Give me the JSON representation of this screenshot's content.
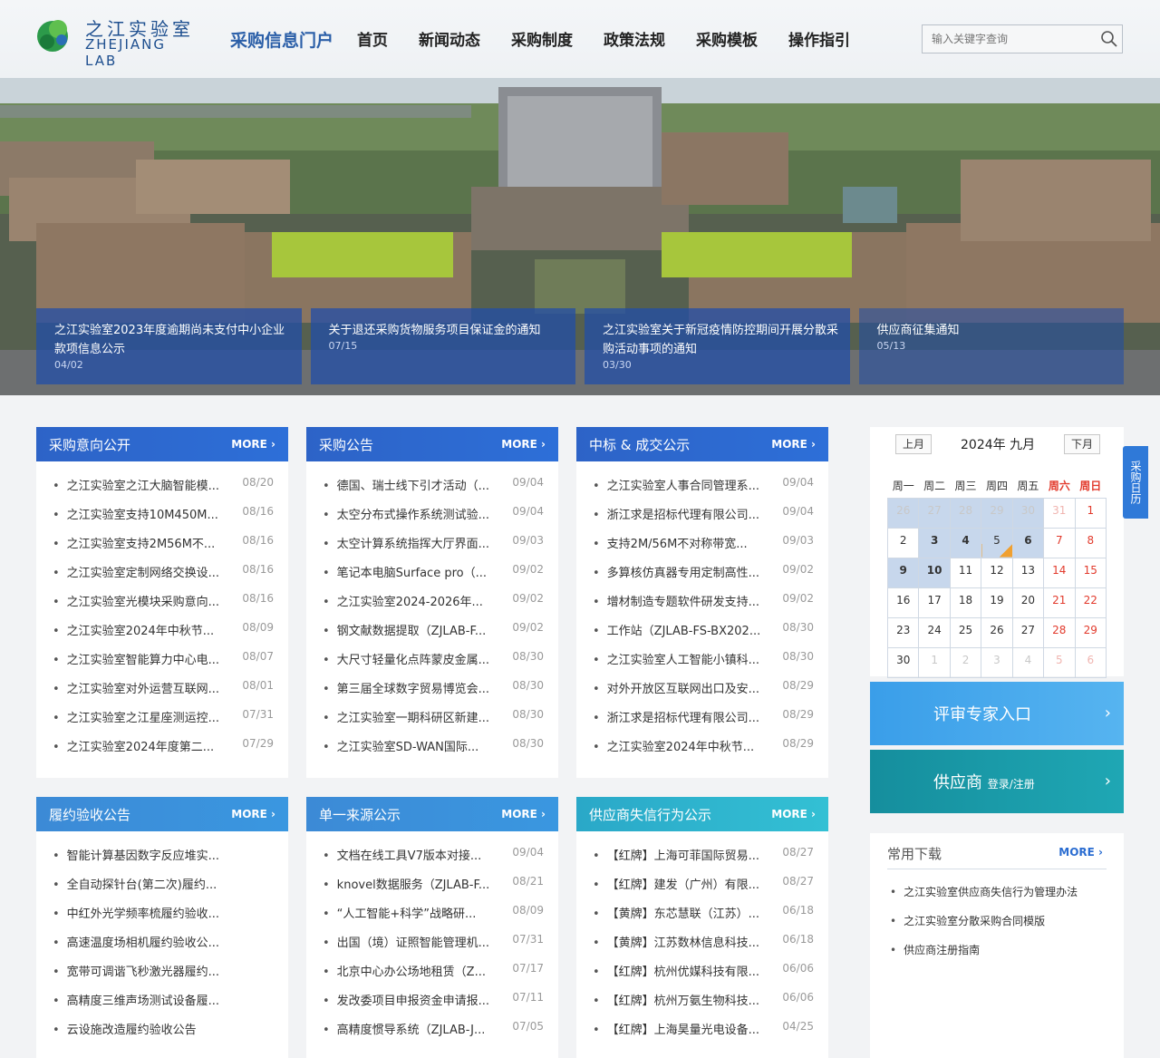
{
  "header": {
    "logo_cn": "之江实验室",
    "logo_en": "ZHEJIANG LAB",
    "portal_title": "采购信息门户",
    "nav": [
      "首页",
      "新闻动态",
      "采购制度",
      "政策法规",
      "采购模板",
      "操作指引"
    ],
    "search_placeholder": "输入关键字查询"
  },
  "banner_news": [
    {
      "title": "之江实验室2023年度逾期尚未支付中小企业款项信息公示",
      "date": "04/02"
    },
    {
      "title": "关于退还采购货物服务项目保证金的通知",
      "date": "07/15"
    },
    {
      "title": "之江实验室关于新冠疫情防控期间开展分散采购活动事项的通知",
      "date": "03/30"
    },
    {
      "title": "供应商征集通知",
      "date": "05/13"
    }
  ],
  "more_label": "MORE",
  "panels": [
    {
      "title": "采购意向公开",
      "items": [
        {
          "t": "之江实验室之江大脑智能模...",
          "d": "08/20"
        },
        {
          "t": "之江实验室支持10M450M...",
          "d": "08/16"
        },
        {
          "t": "之江实验室支持2M56M不...",
          "d": "08/16"
        },
        {
          "t": "之江实验室定制网络交换设...",
          "d": "08/16"
        },
        {
          "t": "之江实验室光模块采购意向...",
          "d": "08/16"
        },
        {
          "t": "之江实验室2024年中秋节...",
          "d": "08/09"
        },
        {
          "t": "之江实验室智能算力中心电...",
          "d": "08/07"
        },
        {
          "t": "之江实验室对外运营互联网...",
          "d": "08/01"
        },
        {
          "t": "之江实验室之江星座测运控...",
          "d": "07/31"
        },
        {
          "t": "之江实验室2024年度第二...",
          "d": "07/29"
        }
      ]
    },
    {
      "title": "采购公告",
      "items": [
        {
          "t": "德国、瑞士线下引才活动（...",
          "d": "09/04"
        },
        {
          "t": "太空分布式操作系统测试验...",
          "d": "09/04"
        },
        {
          "t": "太空计算系统指挥大厅界面...",
          "d": "09/03"
        },
        {
          "t": "笔记本电脑Surface pro（...",
          "d": "09/02"
        },
        {
          "t": "之江实验室2024-2026年...",
          "d": "09/02"
        },
        {
          "t": "钢文献数据提取（ZJLAB-F...",
          "d": "09/02"
        },
        {
          "t": "大尺寸轻量化点阵蒙皮金属...",
          "d": "08/30"
        },
        {
          "t": "第三届全球数字贸易博览会...",
          "d": "08/30"
        },
        {
          "t": "之江实验室一期科研区新建...",
          "d": "08/30"
        },
        {
          "t": "之江实验室SD-WAN国际...",
          "d": "08/30"
        }
      ]
    },
    {
      "title": "中标 & 成交公示",
      "items": [
        {
          "t": "之江实验室人事合同管理系...",
          "d": "09/04"
        },
        {
          "t": "浙江求是招标代理有限公司...",
          "d": "09/04"
        },
        {
          "t": "支持2M/56M不对称带宽...",
          "d": "09/03"
        },
        {
          "t": "多算核仿真器专用定制高性...",
          "d": "09/02"
        },
        {
          "t": "增材制造专题软件研发支持...",
          "d": "09/02"
        },
        {
          "t": "工作站（ZJLAB-FS-BX202...",
          "d": "08/30"
        },
        {
          "t": "之江实验室人工智能小镇科...",
          "d": "08/30"
        },
        {
          "t": "对外开放区互联网出口及安...",
          "d": "08/29"
        },
        {
          "t": "浙江求是招标代理有限公司...",
          "d": "08/29"
        },
        {
          "t": "之江实验室2024年中秋节...",
          "d": "08/29"
        }
      ]
    },
    {
      "title": "履约验收公告",
      "items": [
        {
          "t": "智能计算基因数字反应堆实...",
          "d": ""
        },
        {
          "t": "全自动探针台(第二次)履约...",
          "d": ""
        },
        {
          "t": "中红外光学频率梳履约验收...",
          "d": ""
        },
        {
          "t": "高速温度场相机履约验收公...",
          "d": ""
        },
        {
          "t": "宽带可调谐飞秒激光器履约...",
          "d": ""
        },
        {
          "t": "高精度三维声场测试设备履...",
          "d": ""
        },
        {
          "t": "云设施改造履约验收公告",
          "d": ""
        }
      ]
    },
    {
      "title": "单一来源公示",
      "items": [
        {
          "t": "文档在线工具V7版本对接...",
          "d": "09/04"
        },
        {
          "t": "knovel数据服务（ZJLAB-F...",
          "d": "08/21"
        },
        {
          "t": "“人工智能+科学”战略研...",
          "d": "08/09"
        },
        {
          "t": "出国（境）证照智能管理机...",
          "d": "07/31"
        },
        {
          "t": "北京中心办公场地租赁（Z...",
          "d": "07/17"
        },
        {
          "t": "发改委项目申报资金申请报...",
          "d": "07/11"
        },
        {
          "t": "高精度惯导系统（ZJLAB-J...",
          "d": "07/05"
        }
      ]
    },
    {
      "title": "供应商失信行为公示",
      "items": [
        {
          "t": "【红牌】上海可菲国际贸易...",
          "d": "08/27"
        },
        {
          "t": "【红牌】建发（广州）有限...",
          "d": "08/27"
        },
        {
          "t": "【黄牌】东芯慧联（江苏）...",
          "d": "06/18"
        },
        {
          "t": "【黄牌】江苏数林信息科技...",
          "d": "06/18"
        },
        {
          "t": "【红牌】杭州优媒科技有限...",
          "d": "06/06"
        },
        {
          "t": "【红牌】杭州万氨生物科技...",
          "d": "06/06"
        },
        {
          "t": "【红牌】上海昊量光电设备...",
          "d": "04/25"
        }
      ]
    }
  ],
  "calendar": {
    "prev": "上月",
    "next": "下月",
    "title": "2024年 九月",
    "weekdays": [
      "周一",
      "周二",
      "周三",
      "周四",
      "周五",
      "周六",
      "周日"
    ],
    "weeks": [
      [
        "26",
        "27",
        "28",
        "29",
        "30",
        "31",
        "1"
      ],
      [
        "2",
        "3",
        "4",
        "5",
        "6",
        "7",
        "8"
      ],
      [
        "9",
        "10",
        "11",
        "12",
        "13",
        "14",
        "15"
      ],
      [
        "16",
        "17",
        "18",
        "19",
        "20",
        "21",
        "22"
      ],
      [
        "23",
        "24",
        "25",
        "26",
        "27",
        "28",
        "29"
      ],
      [
        "30",
        "1",
        "2",
        "3",
        "4",
        "5",
        "6"
      ]
    ],
    "side_tab": "采购日历"
  },
  "entries": {
    "expert": "评审专家入口",
    "supplier": "供应商",
    "supplier_sub": "登录/注册"
  },
  "downloads": {
    "title": "常用下载",
    "items": [
      "之江实验室供应商失信行为管理办法",
      "之江实验室分散采购合同模版",
      "供应商注册指南"
    ]
  },
  "colors": {
    "brand": "#2b5fa8",
    "panel_blue": "#2d63c7",
    "panel_lightblue": "#3a8fdc",
    "panel_cyan": "#2eb4cf",
    "expert_entry": "#47a9ee",
    "supplier_entry": "#1a9aa8",
    "weekend_red": "#e23a2c"
  }
}
